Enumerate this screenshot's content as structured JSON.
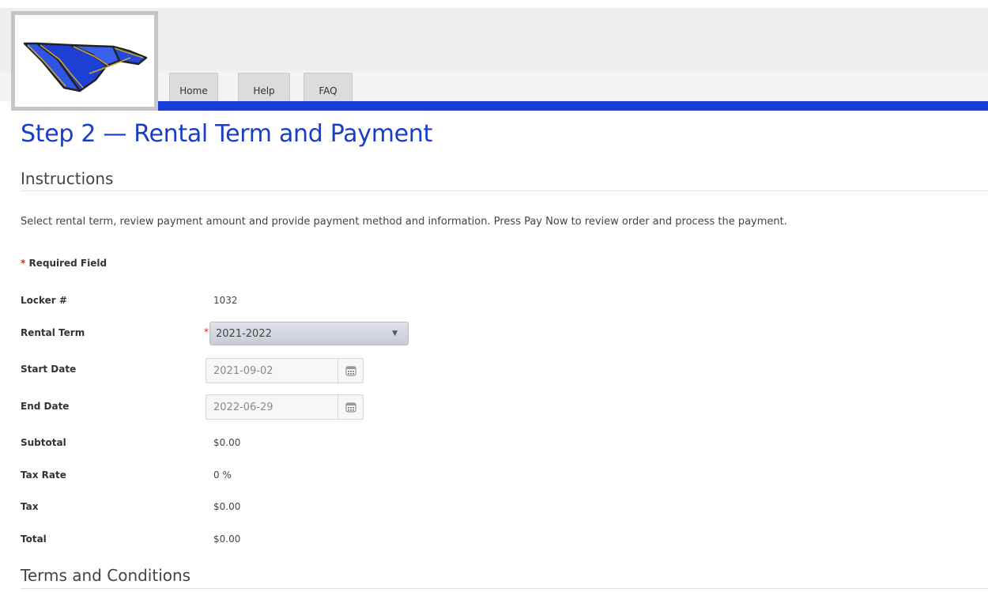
{
  "nav": {
    "tabs": [
      {
        "label": "Home"
      },
      {
        "label": "Help"
      },
      {
        "label": "FAQ"
      }
    ]
  },
  "page": {
    "title": "Step 2 — Rental Term and Payment"
  },
  "instructions": {
    "heading": "Instructions",
    "text": "Select rental term, review payment amount and provide payment method and information. Press Pay Now to review order and process the payment."
  },
  "form": {
    "required_star": "*",
    "required_note": "Required Field",
    "locker": {
      "label": "Locker #",
      "value": "1032"
    },
    "rental_term": {
      "label": "Rental Term",
      "value": "2021-2022"
    },
    "start_date": {
      "label": "Start Date",
      "value": "2021-09-02"
    },
    "end_date": {
      "label": "End Date",
      "value": "2022-06-29"
    },
    "subtotal": {
      "label": "Subtotal",
      "value": "$0.00"
    },
    "tax_rate": {
      "label": "Tax Rate",
      "value": "0 %"
    },
    "tax": {
      "label": "Tax",
      "value": "$0.00"
    },
    "total": {
      "label": "Total",
      "value": "$0.00"
    }
  },
  "terms": {
    "heading": "Terms and Conditions"
  },
  "icons": {
    "logo": "school-logo-icon",
    "calendar": "calendar-icon",
    "dropdown": "chevron-down-icon"
  },
  "colors": {
    "accent": "#1a3dd8",
    "title": "#1a3dc8",
    "required": "#d9261c"
  }
}
